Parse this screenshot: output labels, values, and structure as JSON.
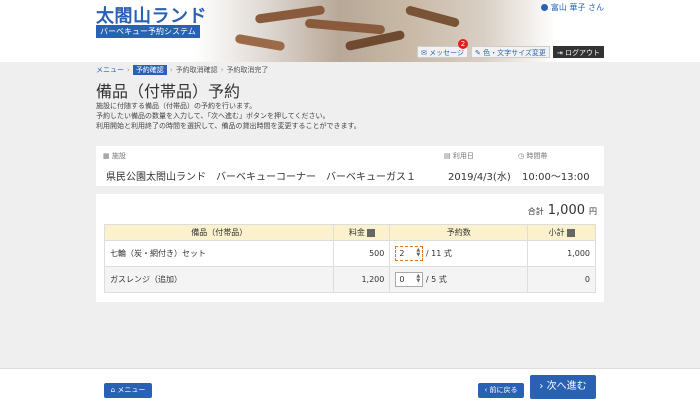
{
  "header": {
    "site_title": "太閤山ランド",
    "subtitle": "バーベキュー予約システム",
    "user": "富山 華子 さん",
    "message_label": "メッセージ",
    "message_count": "2",
    "font_label": "色・文字サイズ変更",
    "logout_label": "ログアウト"
  },
  "breadcrumb": [
    "メニュー",
    "予約確認",
    "予約取消確認",
    "予約取消完了"
  ],
  "page_title": "備品（付帯品）予約",
  "description": [
    "施設に付随する備品（付帯品）の予約を行います。",
    "予約したい備品の数量を入力して、「次へ進む」ボタンを押してください。",
    "利用開始と利用終了の時間を選択して、備品の貸出時間を変更することができます。"
  ],
  "facility": {
    "facility_label": "施設",
    "facility_value": "県民公園太閤山ランド　バーベキューコーナー　バーベキューガス１",
    "date_label": "利用日",
    "date_value": "2019/4/3(水)",
    "time_label": "時間帯",
    "time_value": "10:00～13:00"
  },
  "total": {
    "label": "合計",
    "amount": "1,000",
    "unit": "円"
  },
  "table": {
    "headers": [
      "備品（付帯品）",
      "料金",
      "予約数",
      "小計"
    ],
    "rows": [
      {
        "name": "七輪（炭・網付き）セット",
        "price": "500",
        "qty": "2",
        "max": "/ 11 式",
        "subtotal": "1,000"
      },
      {
        "name": "ガスレンジ（追加）",
        "price": "1,200",
        "qty": "0",
        "max": "/ 5 式",
        "subtotal": "0"
      }
    ]
  },
  "footer": {
    "menu_label": "メニュー",
    "back_label": "前に戻る",
    "next_label": "次へ進む"
  }
}
